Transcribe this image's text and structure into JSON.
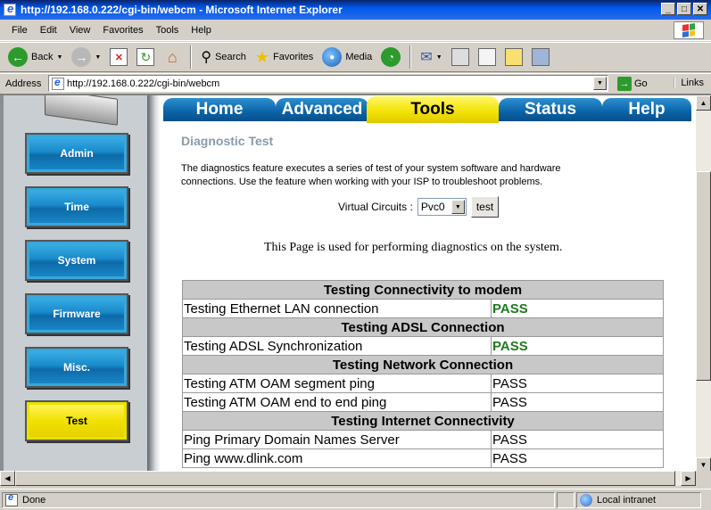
{
  "window": {
    "title": "http://192.168.0.222/cgi-bin/webcm - Microsoft Internet Explorer",
    "controls": [
      "_",
      "□",
      "✕"
    ]
  },
  "menu": [
    "File",
    "Edit",
    "View",
    "Favorites",
    "Tools",
    "Help"
  ],
  "toolbar": {
    "back": "Back",
    "search": "Search",
    "favorites": "Favorites",
    "media": "Media"
  },
  "address": {
    "label": "Address",
    "url": "http://192.168.0.222/cgi-bin/webcm",
    "go": "Go",
    "links": "Links"
  },
  "sidebar": {
    "items": [
      "Admin",
      "Time",
      "System",
      "Firmware",
      "Misc.",
      "Test"
    ],
    "active": "Test"
  },
  "tabs": {
    "items": [
      "Home",
      "Advanced",
      "Tools",
      "Status",
      "Help"
    ],
    "active": "Tools"
  },
  "page": {
    "title": "Diagnostic Test",
    "description": "The diagnostics feature executes a series of test of your system software and hardware connections. Use the feature when working with your ISP to troubleshoot problems.",
    "vc_label": "Virtual Circuits :",
    "vc_value": "Pvc0",
    "test_button": "test",
    "notice": "This Page is used for performing diagnostics on the system."
  },
  "diagnostics": {
    "sections": [
      {
        "heading": "Testing Connectivity to modem",
        "rows": [
          {
            "label": "Testing Ethernet LAN connection",
            "result": "PASS"
          }
        ]
      },
      {
        "heading": "Testing ADSL Connection",
        "rows": [
          {
            "label": "Testing ADSL Synchronization",
            "result": "PASS"
          }
        ]
      },
      {
        "heading": "Testing Network Connection",
        "rows": [
          {
            "label": "Testing ATM OAM segment ping",
            "result": "PASS"
          },
          {
            "label": "Testing ATM OAM end to end ping",
            "result": "PASS"
          }
        ]
      },
      {
        "heading": "Testing Internet Connectivity",
        "rows": [
          {
            "label": "Ping Primary Domain Names Server",
            "result": "PASS"
          },
          {
            "label": "Ping www.dlink.com",
            "result": "PASS"
          }
        ]
      }
    ]
  },
  "status": {
    "left": "Done",
    "zone": "Local intranet"
  },
  "colors": {
    "pass_highlight": "#207a20",
    "tab_blue": "#0b63a8",
    "active_yellow": "#f2e100"
  }
}
